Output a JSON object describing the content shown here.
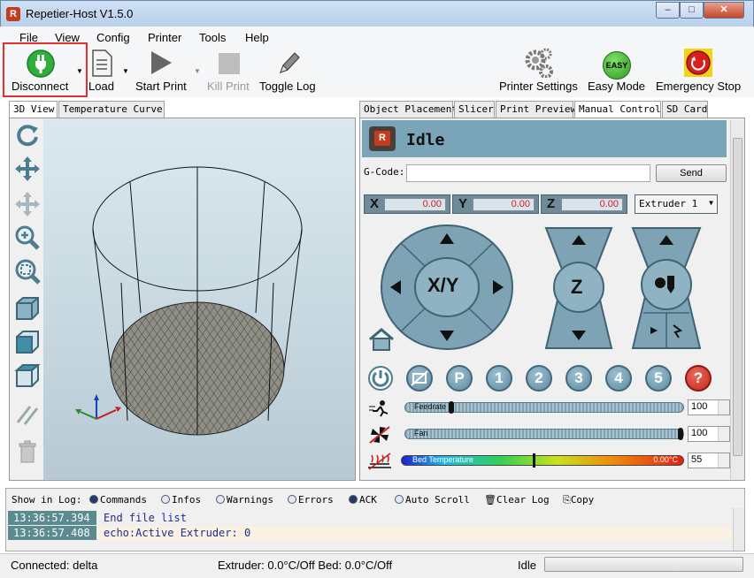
{
  "window": {
    "title": "Repetier-Host V1.5.0",
    "minimize": "–",
    "maximize": "□",
    "close": "✕"
  },
  "menu": [
    "File",
    "View",
    "Config",
    "Printer",
    "Tools",
    "Help"
  ],
  "toolbar": {
    "disconnect": "Disconnect",
    "load": "Load",
    "start_print": "Start Print",
    "kill_print": "Kill Print",
    "toggle_log": "Toggle Log",
    "printer_settings": "Printer Settings",
    "easy_mode": "Easy Mode",
    "easy_badge": "EASY",
    "emergency_stop": "Emergency Stop"
  },
  "left_tabs": [
    "3D View",
    "Temperature Curve"
  ],
  "right_tabs": [
    "Object Placement",
    "Slicer",
    "Print Preview",
    "Manual Control",
    "SD Card"
  ],
  "manual": {
    "status": "Idle",
    "gcode_label": "G-Code:",
    "gcode_value": "",
    "send_label": "Send",
    "x_label": "X",
    "x_value": "0.00",
    "y_label": "Y",
    "y_value": "0.00",
    "z_label": "Z",
    "z_value": "0.00",
    "extruder_select": "Extruder 1",
    "xy_label": "X/Y",
    "z_pad_label": "Z",
    "circle_buttons": [
      "P",
      "1",
      "2",
      "3",
      "4",
      "5",
      "?"
    ],
    "feedrate_label": "Feedrate",
    "feedrate_value": "100",
    "feedrate_level": 0.16,
    "fan_label": "Fan",
    "fan_value": "100",
    "fan_level": 1.0,
    "bed_label": "Bed Temperature",
    "bed_reading": "0.00°C",
    "bed_value": "55",
    "bed_level": 0.47
  },
  "log": {
    "show_label": "Show in Log:",
    "options": [
      "Commands",
      "Infos",
      "Warnings",
      "Errors",
      "ACK",
      "Auto Scroll"
    ],
    "options_on": [
      true,
      false,
      false,
      false,
      true,
      false
    ],
    "clear_label": "Clear Log",
    "copy_label": "Copy",
    "entries": [
      {
        "time": "13:36:57.394",
        "msg": "End file list"
      },
      {
        "time": "13:36:57.408",
        "msg": "echo:Active Extruder: 0"
      }
    ]
  },
  "status": {
    "connection": "Connected: delta",
    "temps": "Extruder: 0.0°C/Off Bed: 0.0°C/Off",
    "state": "Idle"
  },
  "colors": {
    "accent": "#7aa4b8",
    "highlight": "#e03030",
    "value_red": "#d42020"
  }
}
